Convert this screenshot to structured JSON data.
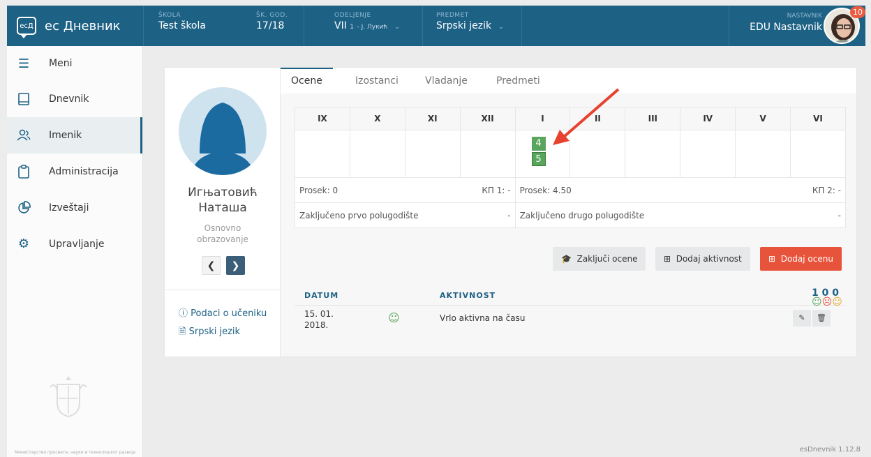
{
  "topbar": {
    "brand": "ес Дневник",
    "logo_text": "ecД",
    "school_label": "ŠKOLA",
    "school": "Test škola",
    "year_label": "ŠK. GOD.",
    "year": "17/18",
    "class_label": "ODELJENJE",
    "class_main": "VII",
    "class_sub": "1",
    "class_teacher": "- J. Лукић",
    "subject_label": "PREDMET",
    "subject": "Srpski jezik",
    "role_label": "NASTAVNIK",
    "user": "EDU Nastavnik",
    "badge": "10"
  },
  "sidebar": {
    "items": [
      {
        "label": "Meni"
      },
      {
        "label": "Dnevnik"
      },
      {
        "label": "Imenik"
      },
      {
        "label": "Administracija"
      },
      {
        "label": "Izveštaji"
      },
      {
        "label": "Upravljanje"
      }
    ],
    "ministry": "Министарство просвете, науке и технолошког развоја"
  },
  "student": {
    "name_line1": "Игњатовић",
    "name_line2": "Наташа",
    "type": "Osnovno obrazovanje",
    "link_info": "Podaci o učeniku",
    "link_subject": "Srpski jezik"
  },
  "tabs": [
    "Ocene",
    "Izostanci",
    "Vladanje",
    "Predmeti"
  ],
  "months": [
    "IX",
    "X",
    "XI",
    "XII",
    "I",
    "II",
    "III",
    "IV",
    "V",
    "VI"
  ],
  "grades": {
    "january": [
      "4",
      "5"
    ]
  },
  "summary": {
    "avg1": "Prosek: 0",
    "kp1": "КП 1: -",
    "avg2": "Prosek: 4.50",
    "kp2": "КП 2: -",
    "closed1": "Zaključeno prvo polugodište",
    "closed1_val": "-",
    "closed2": "Zaključeno drugo polugodište",
    "closed2_val": "-"
  },
  "buttons": {
    "close_grades": "Zaključi ocene",
    "add_activity": "Dodaj aktivnost",
    "add_grade": "Dodaj ocenu"
  },
  "activity": {
    "col_date": "DATUM",
    "col_activity": "AKTIVNOST",
    "count_happy": "1",
    "count_sad": "0",
    "count_neutral": "0",
    "rows": [
      {
        "date": "15. 01. 2018.",
        "text": "Vrlo aktivna na času"
      }
    ]
  },
  "version": "esDnevnik 1.12.8",
  "colors": {
    "primary": "#1d6185",
    "grade": "#5aa55d",
    "danger": "#e8533b",
    "arrow": "#e8412f"
  }
}
